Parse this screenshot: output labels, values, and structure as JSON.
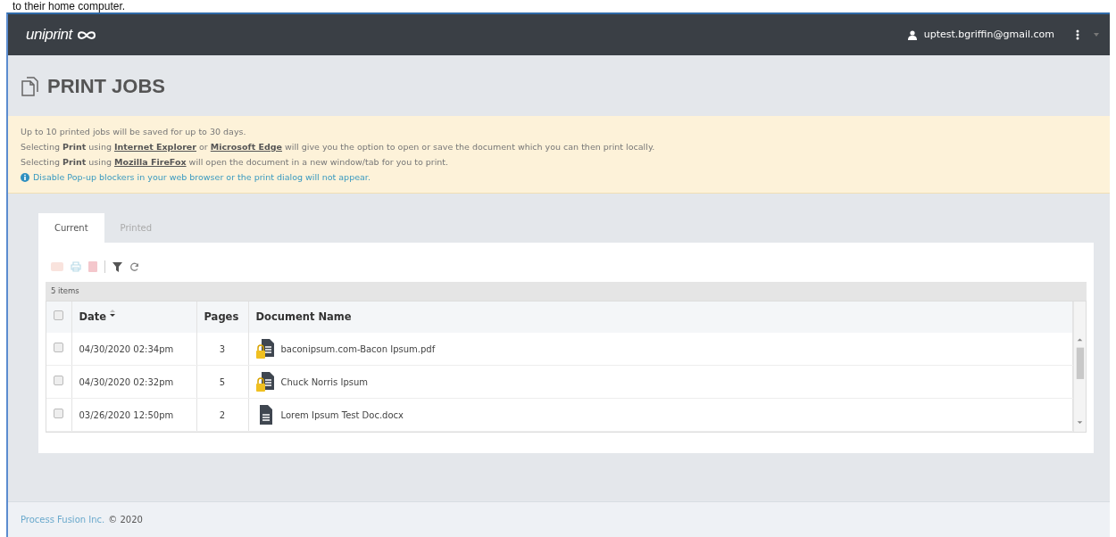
{
  "page_caption": "to their home computer.",
  "navbar": {
    "logo": "uniprint",
    "user_email": "uptest.bgriffin@gmail.com"
  },
  "page_title": "PRINT JOBS",
  "notice": {
    "lines": [
      [
        {
          "kind": "plain",
          "text": "Up to 10 printed jobs will be saved for up to 30 days."
        }
      ],
      [
        {
          "kind": "plain",
          "text": "Selecting "
        },
        {
          "kind": "bold",
          "text": "Print"
        },
        {
          "kind": "plain",
          "text": " using "
        },
        {
          "kind": "link",
          "text": "Internet Explorer"
        },
        {
          "kind": "plain",
          "text": " or "
        },
        {
          "kind": "link",
          "text": "Microsoft Edge"
        },
        {
          "kind": "plain",
          "text": " will give you the option to open or save the document which you can then print locally."
        }
      ],
      [
        {
          "kind": "plain",
          "text": "Selecting "
        },
        {
          "kind": "bold",
          "text": "Print"
        },
        {
          "kind": "plain",
          "text": " using "
        },
        {
          "kind": "link",
          "text": "Mozilla FireFox"
        },
        {
          "kind": "plain",
          "text": " will open the document in a new window/tab for you to print."
        }
      ]
    ],
    "info": "Disable Pop-up blockers in your web browser or the print dialog will not appear."
  },
  "tabs": [
    {
      "label": "Current",
      "selected": true
    },
    {
      "label": "Printed",
      "selected": false
    }
  ],
  "toolbar": {
    "disabled": true
  },
  "item_count": "5 items",
  "table": {
    "columns": [
      "Date",
      "Pages",
      "Document Name"
    ],
    "all_checked": false,
    "rows": [
      {
        "checked": false,
        "date": "04/30/2020 02:34pm",
        "pages": "3",
        "name": "baconipsum.com-Bacon Ipsum.pdf",
        "kind": "locked"
      },
      {
        "checked": false,
        "date": "04/30/2020 02:32pm",
        "pages": "5",
        "name": "Chuck Norris Ipsum",
        "kind": "locked"
      },
      {
        "checked": false,
        "date": "03/26/2020 12:50pm",
        "pages": "2",
        "name": "Lorem Ipsum Test Doc.docx",
        "kind": "plain"
      }
    ]
  },
  "footer": {
    "company": "Process Fusion Inc.",
    "copyright": "© 2020"
  }
}
